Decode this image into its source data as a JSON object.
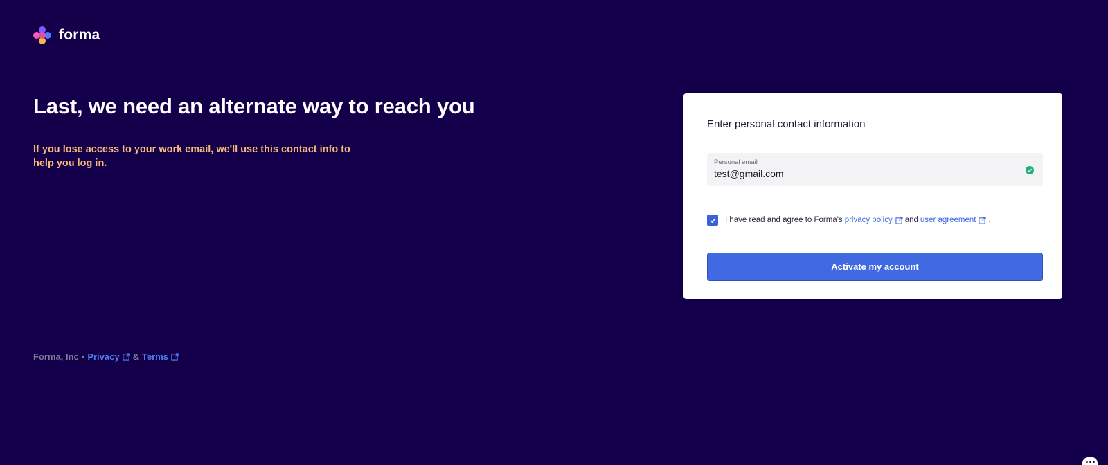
{
  "brand": {
    "name": "forma",
    "colors": [
      "#7c5cff",
      "#f65cba",
      "#f7b84b",
      "#4c7cff"
    ]
  },
  "main": {
    "headline": "Last, we need an alternate way to reach you",
    "subtext": "If you lose access to your work email, we'll use this contact info to help you log in."
  },
  "form": {
    "title": "Enter personal contact information",
    "email": {
      "label": "Personal email",
      "value": "test@gmail.com",
      "valid_icon": "check-circle-icon"
    },
    "agreement": {
      "checked": true,
      "prefix": "I have read and agree to Forma's",
      "privacy_link": "privacy policy",
      "connector": "and",
      "user_agreement_link": "user agreement",
      "suffix": "."
    },
    "submit_label": "Activate my account"
  },
  "footer": {
    "company": "Forma, Inc",
    "separator": "•",
    "privacy": "Privacy",
    "amp": "&",
    "terms": "Terms"
  },
  "colors": {
    "background": "#14004a",
    "accent": "#4169e1",
    "subtext": "#f6b978",
    "link": "#4f7df0",
    "success": "#1fb07a"
  }
}
